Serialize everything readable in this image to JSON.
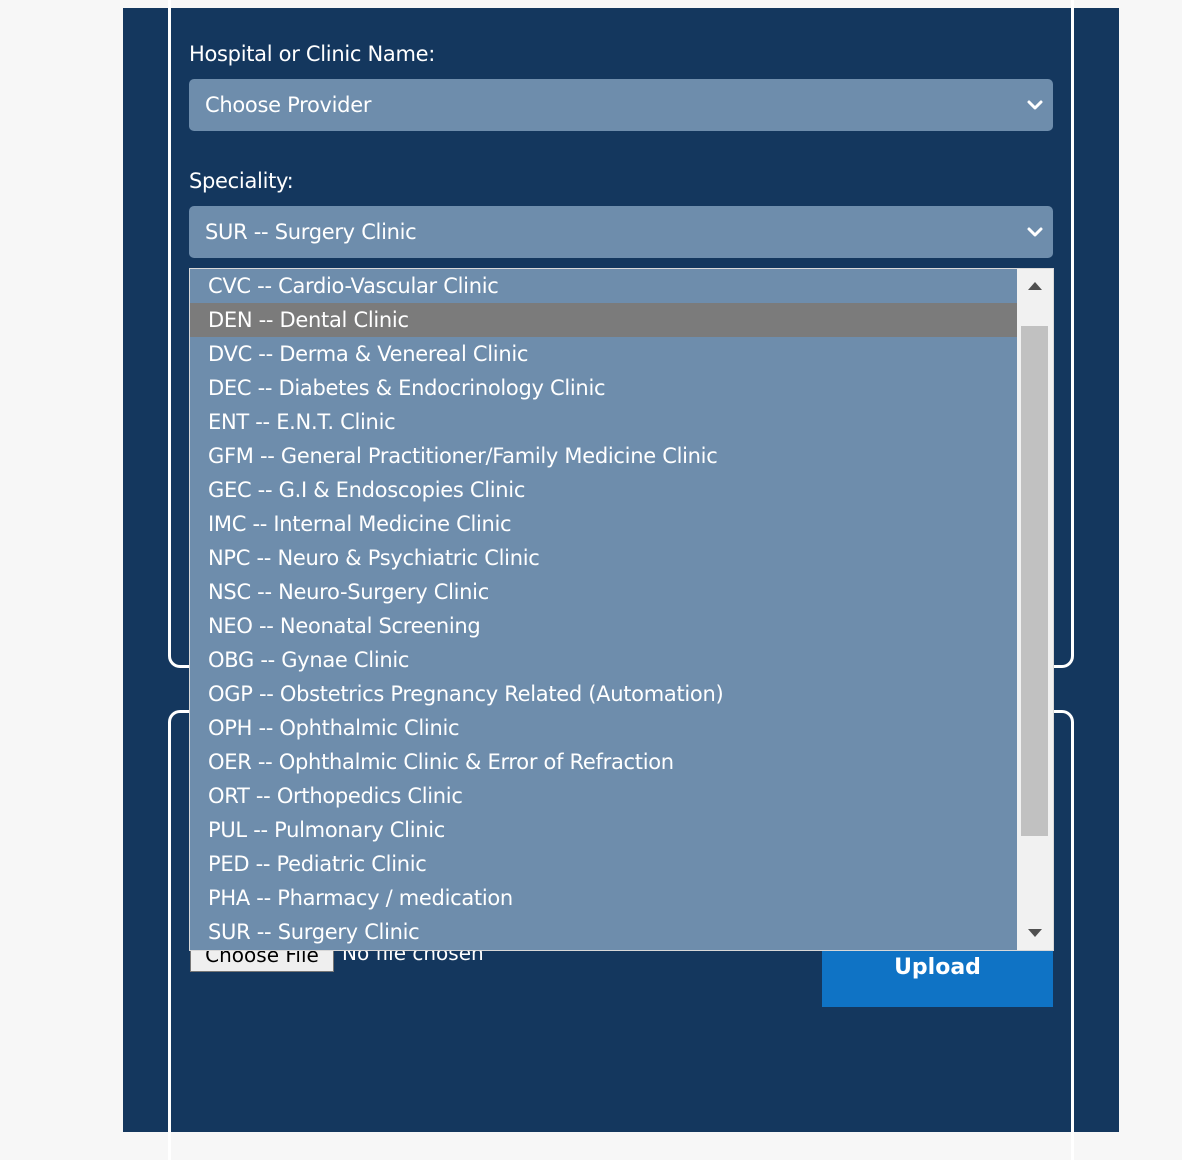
{
  "form": {
    "provider_label": "Hospital or Clinic Name:",
    "provider_value": "Choose Provider",
    "speciality_label": "Speciality:",
    "speciality_value": "SUR -- Surgery Clinic"
  },
  "dropdown": {
    "highlighted_option": "DEN -- Dental Clinic",
    "options": [
      "CVC -- Cardio-Vascular Clinic",
      "DEN -- Dental Clinic",
      "DVC -- Derma & Venereal Clinic",
      "DEC -- Diabetes & Endocrinology Clinic",
      "ENT -- E.N.T. Clinic",
      "GFM -- General Practitioner/Family Medicine Clinic",
      "GEC -- G.I & Endoscopies Clinic",
      "IMC -- Internal Medicine Clinic",
      "NPC -- Neuro & Psychiatric Clinic",
      "NSC -- Neuro-Surgery Clinic",
      "NEO -- Neonatal Screening",
      "OBG -- Gynae Clinic",
      "OGP -- Obstetrics Pregnancy Related (Automation)",
      "OPH -- Ophthalmic Clinic",
      "OER -- Ophthalmic Clinic & Error of Refraction",
      "ORT -- Orthopedics Clinic",
      "PUL -- Pulmonary Clinic",
      "PED -- Pediatric Clinic",
      "PHA -- Pharmacy / medication",
      "SUR -- Surgery Clinic"
    ]
  },
  "upload": {
    "choose_file_label": "Choose File",
    "file_status": "No file chosen",
    "upload_label": "Upload"
  },
  "colors": {
    "panel_bg": "#14375e",
    "select_bg": "#6e8dac",
    "highlight_bg": "#7b7b7b",
    "upload_bg": "#0f73c5"
  },
  "icons": {
    "select_caret": "chevron-down-icon",
    "scroll_up": "triangle-up-icon",
    "scroll_down": "triangle-down-icon"
  }
}
